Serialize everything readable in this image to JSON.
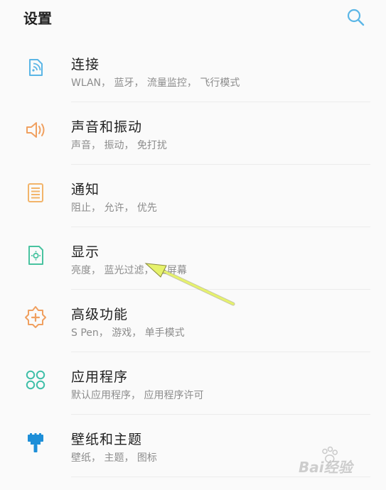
{
  "header": {
    "title": "设置",
    "search_icon": "search-icon"
  },
  "colors": {
    "accent_blue": "#5bb6e6",
    "orange": "#f0a060",
    "yellow_orange": "#f2b46a",
    "green": "#49c3a0",
    "teal": "#3fbfa8",
    "deep_blue": "#1e8fd8",
    "arrow": "#e6f26b"
  },
  "items": [
    {
      "title": "连接",
      "subtitle": "WLAN， 蓝牙， 流量监控， 飞行模式",
      "icon": "connection-icon"
    },
    {
      "title": "声音和振动",
      "subtitle": "声音， 振动， 免打扰",
      "icon": "sound-icon"
    },
    {
      "title": "通知",
      "subtitle": "阻止， 允许， 优先",
      "icon": "notification-icon"
    },
    {
      "title": "显示",
      "subtitle": "亮度， 蓝光过滤， 主屏幕",
      "icon": "display-icon"
    },
    {
      "title": "高级功能",
      "subtitle": "S Pen， 游戏， 单手模式",
      "icon": "advanced-features-icon"
    },
    {
      "title": "应用程序",
      "subtitle": "默认应用程序， 应用程序许可",
      "icon": "apps-icon"
    },
    {
      "title": "壁纸和主题",
      "subtitle": "壁纸， 主题， 图标",
      "icon": "wallpaper-icon"
    }
  ],
  "watermark": {
    "text": "Bai经验"
  }
}
